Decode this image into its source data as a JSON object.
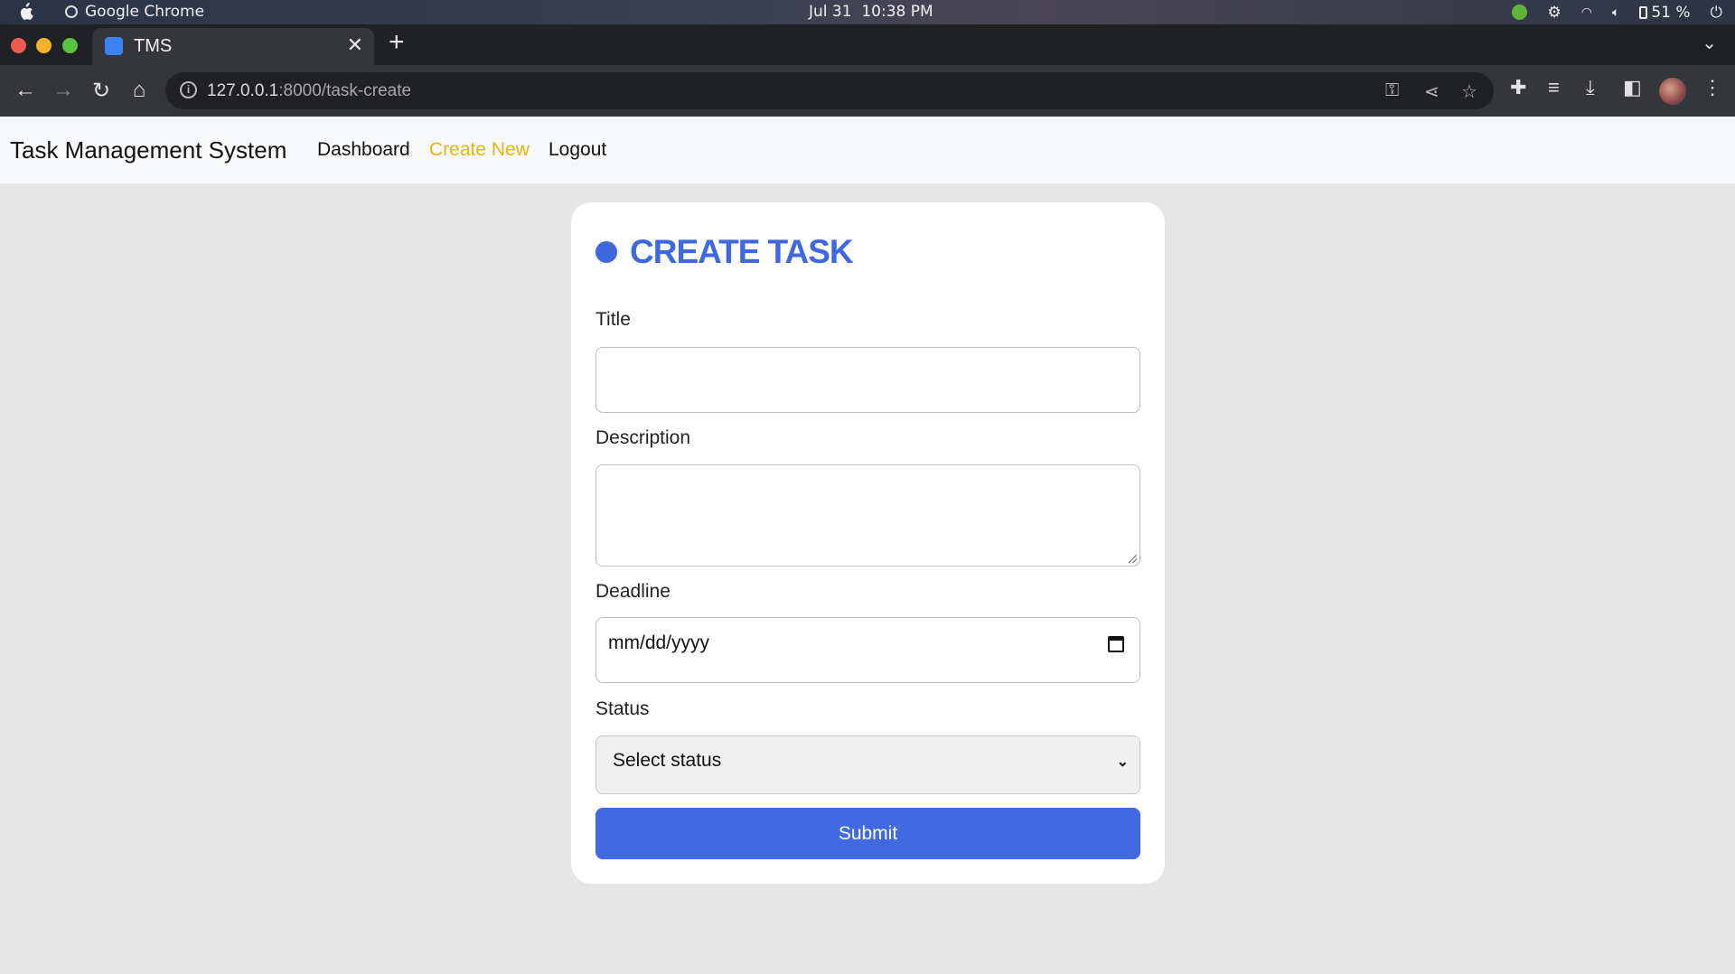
{
  "os_bar": {
    "app_name": "Google Chrome",
    "date": "Jul 31",
    "time": "10:38 PM",
    "battery": "51 %"
  },
  "browser": {
    "tab_title": "TMS",
    "url_host": "127.0.0.1",
    "url_rest": ":8000/task-create"
  },
  "navbar": {
    "brand": "Task Management System",
    "links": [
      "Dashboard",
      "Create New",
      "Logout"
    ],
    "active_link": "Create New",
    "active_color": "#e9b418"
  },
  "form": {
    "heading": "CREATE TASK",
    "title_label": "Title",
    "title_value": "",
    "description_label": "Description",
    "description_value": "",
    "deadline_label": "Deadline",
    "deadline_placeholder": "mm/dd/yyyy",
    "status_label": "Status",
    "status_selected": "Select status",
    "submit_label": "Submit",
    "accent_color": "#4169e1"
  }
}
